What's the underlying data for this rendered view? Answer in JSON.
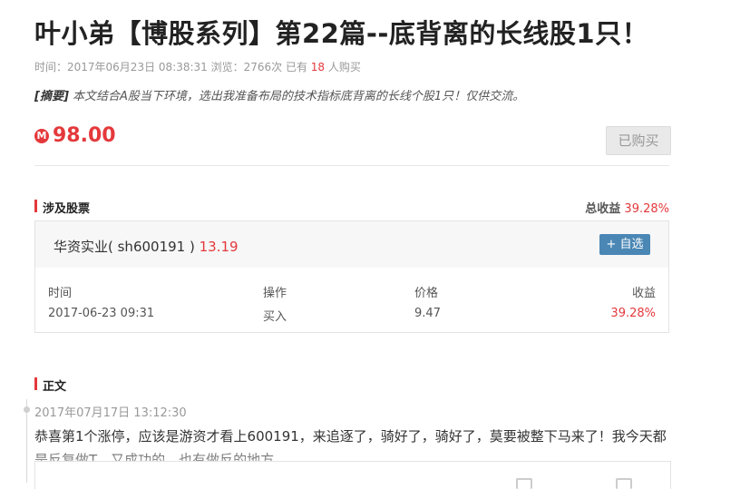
{
  "article": {
    "title": "叶小弟【博股系列】第22篇--底背离的长线股1只！",
    "meta_prefix": "时间：2017年06月23日 08:38:31  浏览：2766次  已有 ",
    "buyers": "18",
    "meta_suffix": " 人购买",
    "summary_label": "[摘要]",
    "summary_text": " 本文结合A股当下环境，选出我准备布局的技术指标底背离的长线个股1只！仅供交流。"
  },
  "price": {
    "icon": "M",
    "value": "98.00",
    "bought_label": "已购买"
  },
  "stocks_section": {
    "label": "涉及股票",
    "total_label": "总收益",
    "total_value": "39.28%",
    "stock_name": "华资实业( sh600191 )",
    "stock_price": "13.19",
    "add_label": "+ 自选",
    "headers": [
      "时间",
      "操作",
      "价格",
      "收益"
    ],
    "row": [
      "2017-06-23 09:31",
      "买入",
      "9.47",
      "39.28%"
    ]
  },
  "body_section": {
    "label": "正文",
    "post_time": "2017年07月17日 13:12:30",
    "post_text": "恭喜第1个涨停，应该是游资才看上600191，来追逐了，骑好了，骑好了，莫要被整下马来了！我今天都是反复做T，又成功的，也有做反的地方。"
  },
  "colors": {
    "accent": "#e4393c",
    "button_blue": "#4a87b5"
  }
}
